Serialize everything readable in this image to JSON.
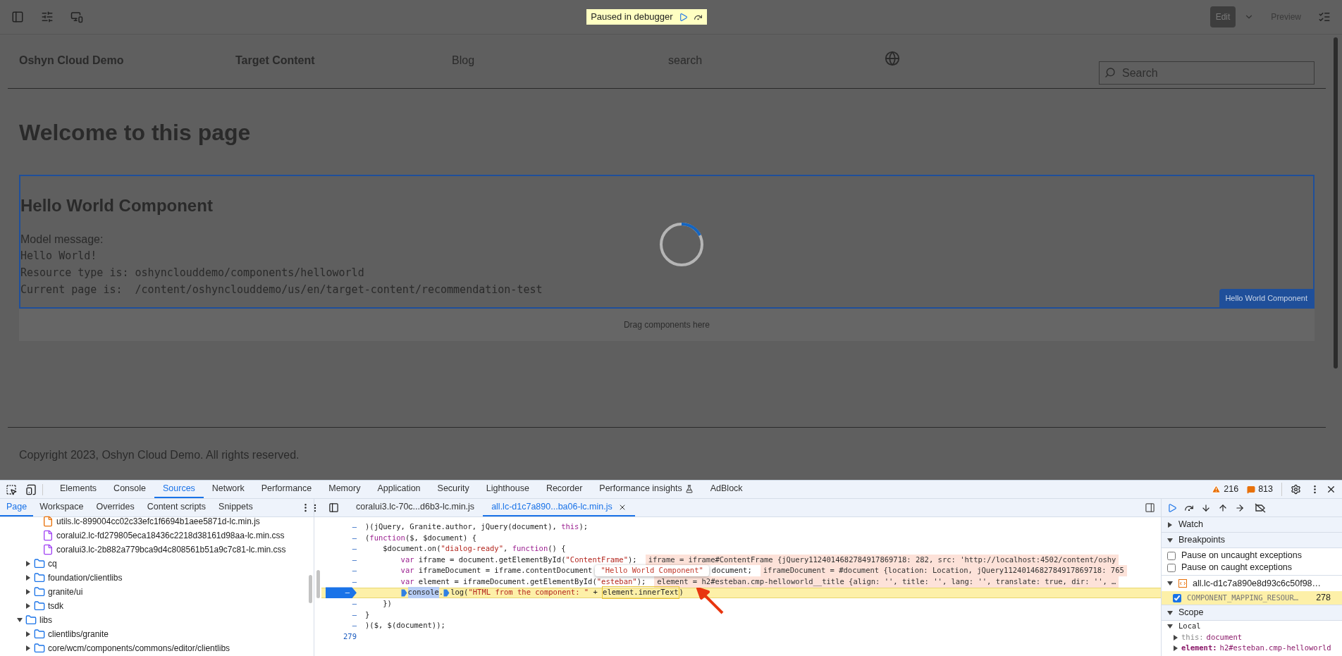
{
  "toolbar": {
    "debugger_banner": "Paused in debugger",
    "edit_button": {
      "label": "Edit",
      "selected": true
    },
    "preview_button": {
      "label": "Preview",
      "selected": false
    }
  },
  "page": {
    "nav": [
      {
        "label": "Oshyn Cloud Demo",
        "kind": "strong"
      },
      {
        "label": "Target Content",
        "kind": "strong"
      },
      {
        "label": "Blog",
        "kind": "plain"
      },
      {
        "label": "search",
        "kind": "plain"
      }
    ],
    "search": {
      "placeholder": "Search"
    },
    "heading": "Welcome to this page",
    "component": {
      "title": "Hello World Component",
      "lines": [
        {
          "text": "Model message:",
          "kind": "prose"
        },
        {
          "text": "Hello World!",
          "kind": "code"
        },
        {
          "text": "Resource type is: oshynclouddemo/components/helloworld",
          "kind": "code"
        },
        {
          "text": "Current page is:  /content/oshynclouddemo/us/en/target-content/recommendation-test",
          "kind": "code"
        }
      ],
      "label": "Hello World Component"
    },
    "drop_zone": "Drag components here",
    "footer": "Copyright 2023, Oshyn Cloud Demo. All rights reserved."
  },
  "devtools": {
    "tabs": [
      {
        "label": "Elements",
        "selected": false
      },
      {
        "label": "Console",
        "selected": false
      },
      {
        "label": "Sources",
        "selected": true
      },
      {
        "label": "Network",
        "selected": false
      },
      {
        "label": "Performance",
        "selected": false
      },
      {
        "label": "Memory",
        "selected": false
      },
      {
        "label": "Application",
        "selected": false
      },
      {
        "label": "Security",
        "selected": false
      },
      {
        "label": "Lighthouse",
        "selected": false
      },
      {
        "label": "Recorder",
        "selected": false
      },
      {
        "label": "Performance insights",
        "selected": false
      },
      {
        "label": "AdBlock",
        "selected": false
      }
    ],
    "warnings": "216",
    "issues": "813",
    "nav_tabs": [
      {
        "label": "Page",
        "selected": true
      },
      {
        "label": "Workspace",
        "selected": false
      },
      {
        "label": "Overrides",
        "selected": false
      },
      {
        "label": "Content scripts",
        "selected": false
      },
      {
        "label": "Snippets",
        "selected": false
      }
    ],
    "tree": [
      {
        "children": [
          {
            "children": [
              {
                "label": "utils.lc-899004cc02c33efc1f6694b1aee5871d-lc.min.js",
                "kind": "script"
              },
              {
                "label": "coralui2.lc-fd279805eca18436c2218d38161d98aa-lc.min.css",
                "kind": "style"
              },
              {
                "label": "coralui3.lc-2b882a779bca9d4c808561b51a9c7c81-lc.min.css",
                "kind": "style"
              }
            ]
          },
          {
            "label": "cq",
            "kind": "folder",
            "expanded": false
          },
          {
            "label": "foundation/clientlibs",
            "kind": "folder",
            "expanded": false
          },
          {
            "label": "granite/ui",
            "kind": "folder",
            "expanded": false
          },
          {
            "label": "tsdk",
            "kind": "folder",
            "expanded": false
          }
        ]
      },
      {
        "label": "libs",
        "kind": "folder",
        "expanded": true,
        "children": [
          {
            "label": "clientlibs/granite",
            "kind": "folder",
            "expanded": false
          },
          {
            "label": "core/wcm/components/commons/editor/clientlibs",
            "kind": "folder",
            "expanded": false
          }
        ]
      }
    ],
    "file_tabs": [
      {
        "label": "coralui3.lc-70c...d6b3-lc.min.js",
        "selected": false
      },
      {
        "label": "all.lc-d1c7a890...ba06-lc.min.js",
        "selected": true
      }
    ],
    "code": [
      {
        "gutter": "–",
        "breakpoint": false,
        "paused": false,
        "tokens": [
          {
            "text": ")(jQuery, Granite.author, jQuery(document), ",
            "kind": "plain"
          },
          {
            "text": "this",
            "kind": "keyword"
          },
          {
            "text": ");",
            "kind": "plain"
          }
        ]
      },
      {
        "gutter": "–",
        "breakpoint": false,
        "paused": false,
        "tokens": [
          {
            "text": "(",
            "kind": "plain"
          },
          {
            "text": "function",
            "kind": "keyword"
          },
          {
            "text": "($, $document) {",
            "kind": "plain"
          }
        ]
      },
      {
        "gutter": "–",
        "breakpoint": false,
        "paused": false,
        "tokens": [
          {
            "text": "    $document.on(",
            "kind": "plain"
          },
          {
            "text": "\"dialog-ready\"",
            "kind": "string"
          },
          {
            "text": ", ",
            "kind": "plain"
          },
          {
            "text": "function",
            "kind": "keyword"
          },
          {
            "text": "() {",
            "kind": "plain"
          }
        ]
      },
      {
        "gutter": "–",
        "breakpoint": false,
        "paused": false,
        "tokens": [
          {
            "text": "        var",
            "kind": "keyword"
          },
          {
            "text": " iframe = document.getElementById(",
            "kind": "plain"
          },
          {
            "text": "\"ContentFrame\"",
            "kind": "string"
          },
          {
            "text": ");",
            "kind": "plain"
          },
          {
            "text": "iframe = iframe#ContentFrame {jQuery1124014682784917869718: 282, src: 'http://localhost:4502/content/oshy",
            "kind": "value"
          }
        ]
      },
      {
        "gutter": "–",
        "breakpoint": false,
        "paused": false,
        "tokens": [
          {
            "text": "        var",
            "kind": "keyword"
          },
          {
            "text": " iframeDocument = iframe.contentDocument",
            "kind": "plain"
          },
          {
            "text": "\"Hello World Component\"",
            "kind": "tooltip"
          },
          {
            "text": "document;",
            "kind": "plain"
          },
          {
            "text": "iframeDocument = #document {location: Location, jQuery1124014682784917869718: 765",
            "kind": "value"
          }
        ]
      },
      {
        "gutter": "–",
        "breakpoint": false,
        "paused": false,
        "tokens": [
          {
            "text": "        var",
            "kind": "keyword"
          },
          {
            "text": " element = iframeDocument.getElementById(",
            "kind": "plain"
          },
          {
            "text": "\"esteban\"",
            "kind": "string"
          },
          {
            "text": ");",
            "kind": "plain"
          },
          {
            "text": "element = h2#esteban.cmp-helloworld__title {align: '', title: '', lang: '', translate: true, dir: '', …",
            "kind": "value"
          }
        ]
      },
      {
        "gutter": "–",
        "breakpoint": true,
        "paused": true,
        "tokens": [
          {
            "kind": "indent"
          },
          {
            "kind": "step"
          },
          {
            "text": "console",
            "kind": "selection"
          },
          {
            "text": ".",
            "kind": "plain"
          },
          {
            "kind": "step"
          },
          {
            "text": "log(",
            "kind": "plain"
          },
          {
            "text": "\"HTML from the component: \"",
            "kind": "string"
          },
          {
            "text": " + ",
            "kind": "plain"
          },
          {
            "text": "element.innerText",
            "kind": "hover"
          },
          {
            "text": ")",
            "kind": "plain"
          }
        ]
      },
      {
        "gutter": "–",
        "breakpoint": false,
        "paused": false,
        "tokens": [
          {
            "text": "    })",
            "kind": "plain"
          }
        ]
      },
      {
        "gutter": "–",
        "breakpoint": false,
        "paused": false,
        "tokens": [
          {
            "text": "}",
            "kind": "plain"
          }
        ]
      },
      {
        "gutter": "–",
        "breakpoint": false,
        "paused": false,
        "tokens": [
          {
            "text": ")($, $(document));",
            "kind": "plain"
          }
        ]
      },
      {
        "gutter": "279",
        "breakpoint": false,
        "paused": false
      }
    ],
    "sidebar": {
      "watch": {
        "label": "Watch",
        "expanded": false
      },
      "breakpoints": {
        "label": "Breakpoints",
        "expanded": true,
        "options": [
          {
            "label": "Pause on uncaught exceptions",
            "checked": false
          },
          {
            "label": "Pause on caught exceptions",
            "checked": false
          }
        ],
        "file": {
          "label": "all.lc-d1c7a890e8d93c6c50f98…",
          "expanded": true,
          "items": [
            {
              "label": "COMPONENT_MAPPING_RESOUR…",
              "line": "278",
              "checked": true
            }
          ]
        }
      },
      "scope": {
        "label": "Scope",
        "expanded": true,
        "local": {
          "label": "Local",
          "expanded": true,
          "entries": [
            {
              "name": "this:",
              "value": "document",
              "kind": "plain"
            },
            {
              "name": "element:",
              "value": "h2#esteban.cmp-helloworld",
              "kind": "strong"
            }
          ]
        }
      }
    }
  }
}
